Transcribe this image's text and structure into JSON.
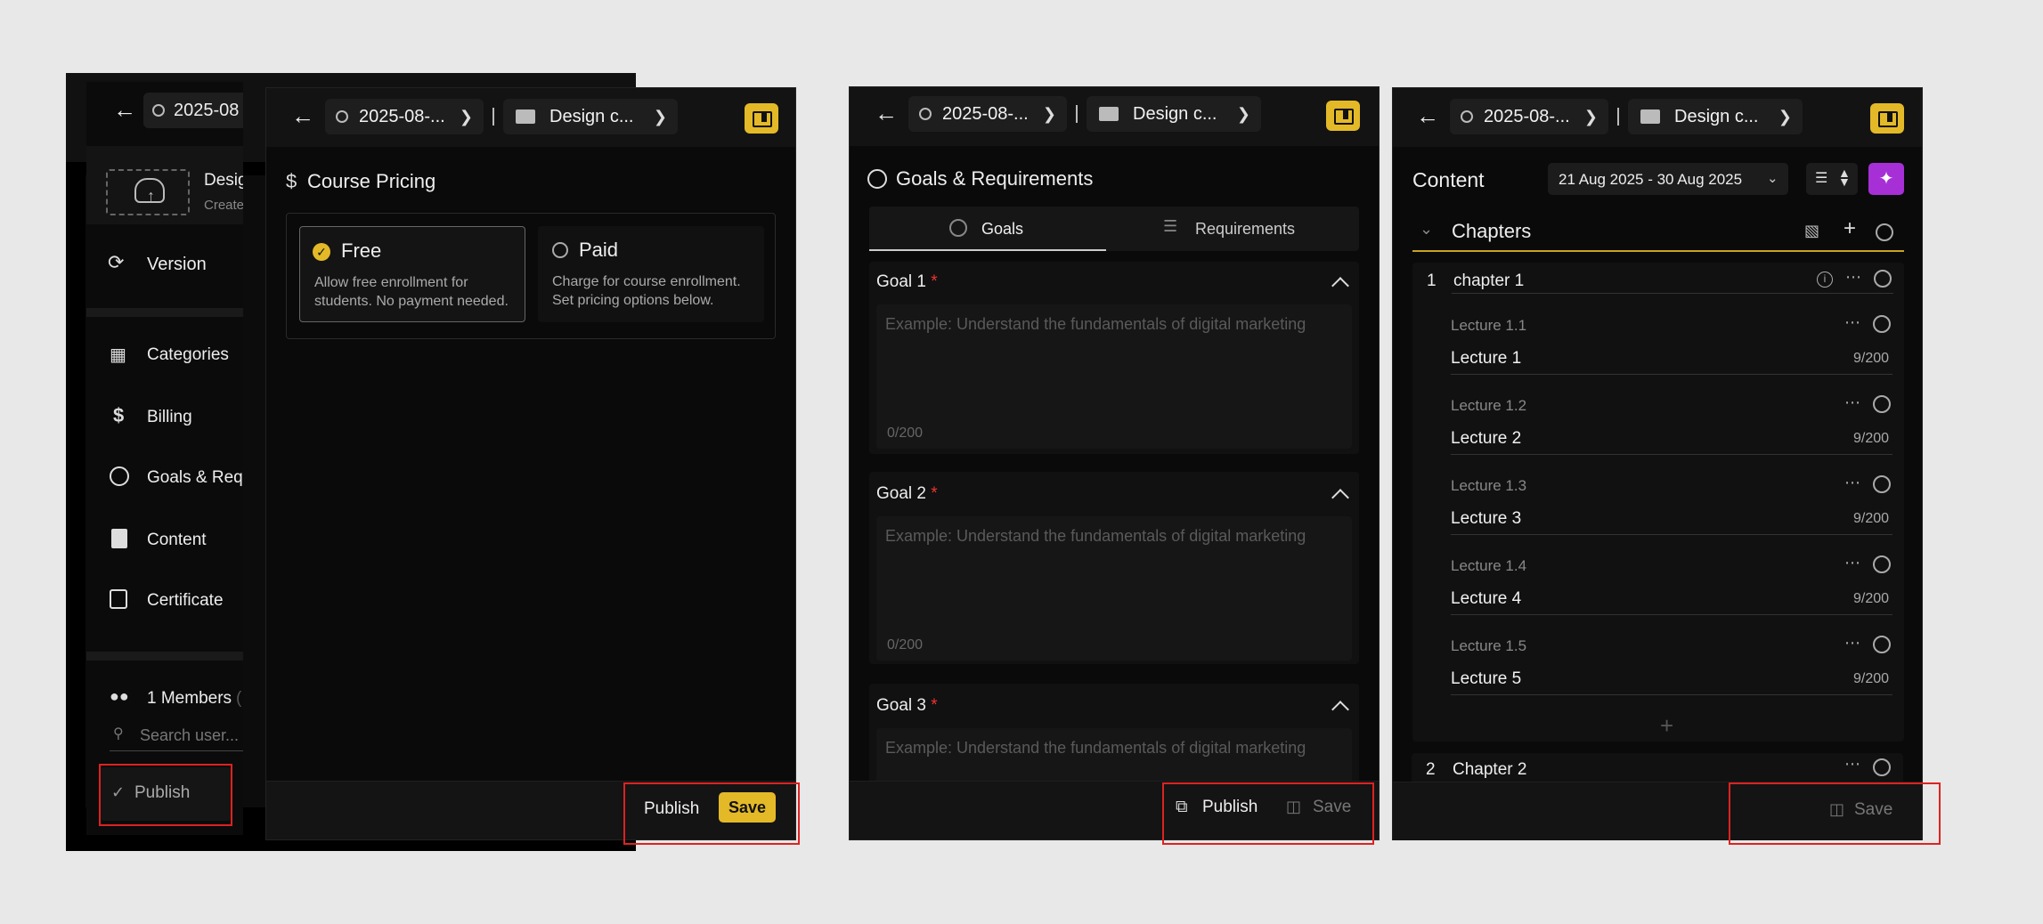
{
  "breadcrumb": {
    "date": "2025-08-...",
    "date_short": "2025-08",
    "course": "Design c..."
  },
  "sidebar": {
    "course_title": "Desig",
    "course_sub": "Create",
    "version": "Version",
    "items": [
      "Categories",
      "Billing",
      "Goals & Requ",
      "Content",
      "Certificate"
    ],
    "members": "1 Members",
    "members_tail": "(",
    "search_placeholder": "Search user...",
    "publish": "Publish"
  },
  "pricing": {
    "title": "Course Pricing",
    "free_label": "Free",
    "free_desc": "Allow free enrollment for students. No payment needed.",
    "paid_label": "Paid",
    "paid_desc": "Charge for course enrollment. Set pricing options below.",
    "publish": "Publish",
    "save": "Save"
  },
  "goals": {
    "title": "Goals & Requirements",
    "tab_goals": "Goals",
    "tab_requirements": "Requirements",
    "items": [
      {
        "label": "Goal 1",
        "placeholder": "Example: Understand the fundamentals of digital marketing",
        "count": "0/200"
      },
      {
        "label": "Goal 2",
        "placeholder": "Example: Understand the fundamentals of digital marketing",
        "count": "0/200"
      },
      {
        "label": "Goal 3",
        "placeholder": "Example: Understand the fundamentals of digital marketing",
        "count": ""
      }
    ],
    "req_mark": "*",
    "publish": "Publish",
    "save": "Save"
  },
  "content": {
    "title": "Content",
    "date_range": "21 Aug 2025 - 30 Aug 2025",
    "chapters_label": "Chapters",
    "chapter1_num": "1",
    "chapter1_name": "chapter 1",
    "lectures": [
      {
        "code": "Lecture 1.1",
        "name": "Lecture 1",
        "count": "9/200"
      },
      {
        "code": "Lecture 1.2",
        "name": "Lecture 2",
        "count": "9/200"
      },
      {
        "code": "Lecture 1.3",
        "name": "Lecture 3",
        "count": "9/200"
      },
      {
        "code": "Lecture 1.4",
        "name": "Lecture 4",
        "count": "9/200"
      },
      {
        "code": "Lecture 1.5",
        "name": "Lecture 5",
        "count": "9/200"
      }
    ],
    "chapter2_num": "2",
    "chapter2_name": "Chapter 2",
    "save": "Save"
  },
  "colors": {
    "accent": "#e4b928",
    "bg": "#0a0a0a",
    "panel": "#131313",
    "highlight": "#d22222",
    "ai": "#a72fd6"
  }
}
